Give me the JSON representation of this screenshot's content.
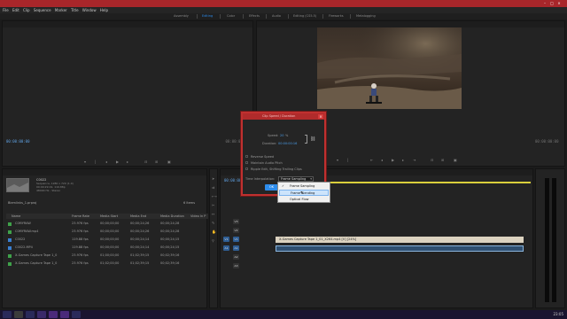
{
  "window": {
    "title": ""
  },
  "menu": [
    "File",
    "Edit",
    "Clip",
    "Sequence",
    "Marker",
    "Title",
    "Window",
    "Help"
  ],
  "workspaces": [
    {
      "label": "Assembly",
      "active": false
    },
    {
      "label": "Editing",
      "active": true
    },
    {
      "label": "Color",
      "active": false
    },
    {
      "label": "Effects",
      "active": false
    },
    {
      "label": "Audio",
      "active": false
    },
    {
      "label": "Editing (CS5.5)",
      "active": false
    },
    {
      "label": "Fireworks",
      "active": false
    },
    {
      "label": "Metalogging",
      "active": false
    }
  ],
  "source_monitor": {
    "tabs": [
      "",
      "",
      "",
      ""
    ],
    "timecode_left": "00:00:00:00",
    "timecode_right": "00:00:00:00"
  },
  "program_monitor": {
    "tab": "",
    "timecode_left": "00:00:00:00",
    "timecode_right": "00:00:00:00"
  },
  "project": {
    "tabs": [
      "",
      "",
      "",
      "",
      "",
      ""
    ],
    "clip_name": "C0022",
    "clip_info": [
      "Sequence, 1280 x 720 (1.0)",
      "00:00:29:19, 119.88p",
      "48000 Hz - Stereo"
    ],
    "bin": "Biemlinks_1.prproj",
    "item_count": "6 Items",
    "columns": [
      "Name",
      "Frame Rate",
      "Media Start",
      "Media End",
      "Media Duration",
      "Video In P"
    ],
    "rows": [
      {
        "name": "C0MYRAW",
        "rate": "23.976 fps",
        "start": "00;00;00;00",
        "end": "00;00;24;26",
        "dur": "00;00;24;28",
        "color": "#3fa24a"
      },
      {
        "name": "C0MYRAW.mp4",
        "rate": "23.976 fps",
        "start": "00;00;00;00",
        "end": "00;00;24;26",
        "dur": "00;00;24;28",
        "color": "#3fa24a"
      },
      {
        "name": "C0022",
        "rate": "119.88 fps",
        "start": "00;00;00;00",
        "end": "00;00;24;14",
        "dur": "00;00;24;15",
        "color": "#3a7fd0"
      },
      {
        "name": "C0022.MP4",
        "rate": "119.88 fps",
        "start": "00;00;00;00",
        "end": "00;00;24;14",
        "dur": "00;00;24;15",
        "color": "#3a7fd0"
      },
      {
        "name": "X-Games Capture Tape 1_0",
        "rate": "23.976 fps",
        "start": "01;00;00;00",
        "end": "01;02;39;15",
        "dur": "00;02;39;16",
        "color": "#3fa24a"
      },
      {
        "name": "X-Games Capture Tape 1_0",
        "rate": "23.976 fps",
        "start": "01;02;00;00",
        "end": "01;02;39;15",
        "dur": "00;02;39;16",
        "color": "#3fa24a"
      }
    ]
  },
  "timeline": {
    "timecode": "00:00:00:00",
    "tracks": [
      "V3",
      "V2",
      "V1",
      "A1",
      "A2",
      "A3"
    ],
    "clip_video_label": "X-Games Capture Tape 1_01_X264.mp4 [V] [24%]",
    "clip_audio_label": ""
  },
  "dialog": {
    "title": "Clip Speed / Duration",
    "speed_label": "Speed:",
    "speed_value": "20",
    "speed_unit": "%",
    "duration_label": "Duration:",
    "duration_value": "00:00:00:16",
    "reverse_label": "Reverse Speed",
    "maintain_label": "Maintain Audio Pitch",
    "ripple_label": "Ripple Edit, Shifting Trailing Clips",
    "interp_label": "Time Interpolation:",
    "interp_value": "Frame Sampling",
    "ok_label": "OK",
    "options": [
      "Frame Sampling",
      "Frame Blending",
      "Optical Flow"
    ],
    "selected_index": 0,
    "hover_index": 1
  },
  "taskbar": {
    "clock": "23:05"
  },
  "colors": {
    "accent": "#2d8ceb",
    "titlebar": "#a8262a",
    "video_clip": "#dcd3c0",
    "audio_clip": "#2f4f70"
  }
}
